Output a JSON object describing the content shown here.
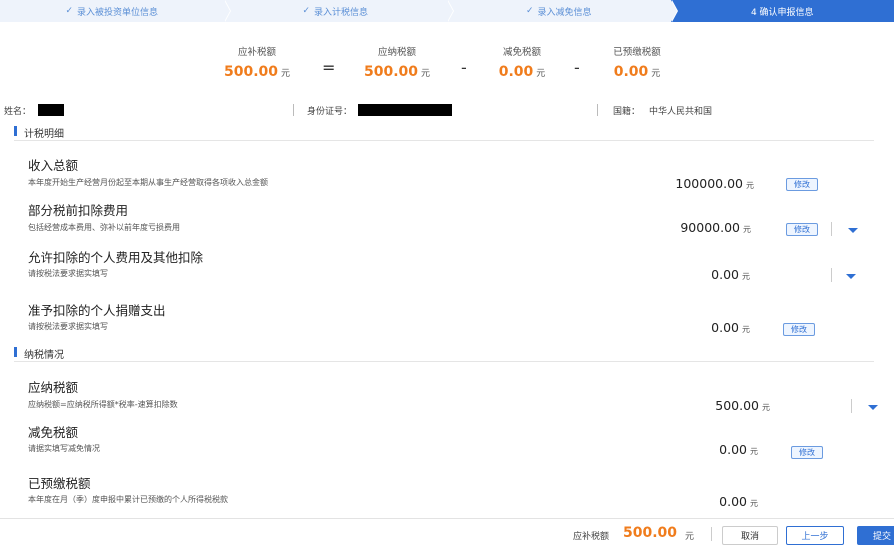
{
  "steps": [
    {
      "label": "录入被投资单位信息",
      "done": true
    },
    {
      "label": "录入计税信息",
      "done": true
    },
    {
      "label": "录入减免信息",
      "done": true
    },
    {
      "label": "4  确认申报信息",
      "done": false
    }
  ],
  "summary": {
    "items": [
      {
        "label": "应补税额",
        "value": "500.00",
        "unit": "元"
      },
      {
        "label": "应纳税额",
        "value": "500.00",
        "unit": "元"
      },
      {
        "label": "减免税额",
        "value": "0.00",
        "unit": "元"
      },
      {
        "label": "已预缴税额",
        "value": "0.00",
        "unit": "元"
      }
    ],
    "ops": [
      "=",
      "-",
      "-"
    ]
  },
  "person": {
    "name_label": "姓名：",
    "id_label": "身份证号：",
    "nationality_label": "国籍：",
    "nationality_value": "中华人民共和国"
  },
  "section1": {
    "title": "计税明细",
    "rows": [
      {
        "title": "收入总额",
        "desc": "本年度开始生产经营月份起至本期从事生产经营取得各项收入总金额",
        "value": "100000.00",
        "unit": "元",
        "action": "修改"
      },
      {
        "title": "部分税前扣除费用",
        "desc": "包括经营成本费用、弥补以前年度亏损费用",
        "value": "90000.00",
        "unit": "元",
        "action": "修改"
      },
      {
        "title": "允许扣除的个人费用及其他扣除",
        "desc": "请按税法要求据实填写",
        "value": "0.00",
        "unit": "元"
      },
      {
        "title": "准予扣除的个人捐赠支出",
        "desc": "请按税法要求据实填写",
        "value": "0.00",
        "unit": "元",
        "action": "修改"
      }
    ]
  },
  "section2": {
    "title": "纳税情况",
    "rows": [
      {
        "title": "应纳税额",
        "desc": "应纳税额=应纳税所得额*税率-速算扣除数",
        "value": "500.00",
        "unit": "元"
      },
      {
        "title": "减免税额",
        "desc": "请据实填写减免情况",
        "value": "0.00",
        "unit": "元",
        "action": "修改"
      },
      {
        "title": "已预缴税额",
        "desc": "本年度在月（季）度申报中累计已预缴的个人所得税税款",
        "value": "0.00",
        "unit": "元"
      }
    ]
  },
  "footer": {
    "label": "应补税额",
    "value": "500.00",
    "unit": "元",
    "cancel": "取消",
    "prev": "上一步",
    "submit": "提交"
  },
  "colors": {
    "accent": "#2f6fd3",
    "amount": "#f07c1c"
  }
}
